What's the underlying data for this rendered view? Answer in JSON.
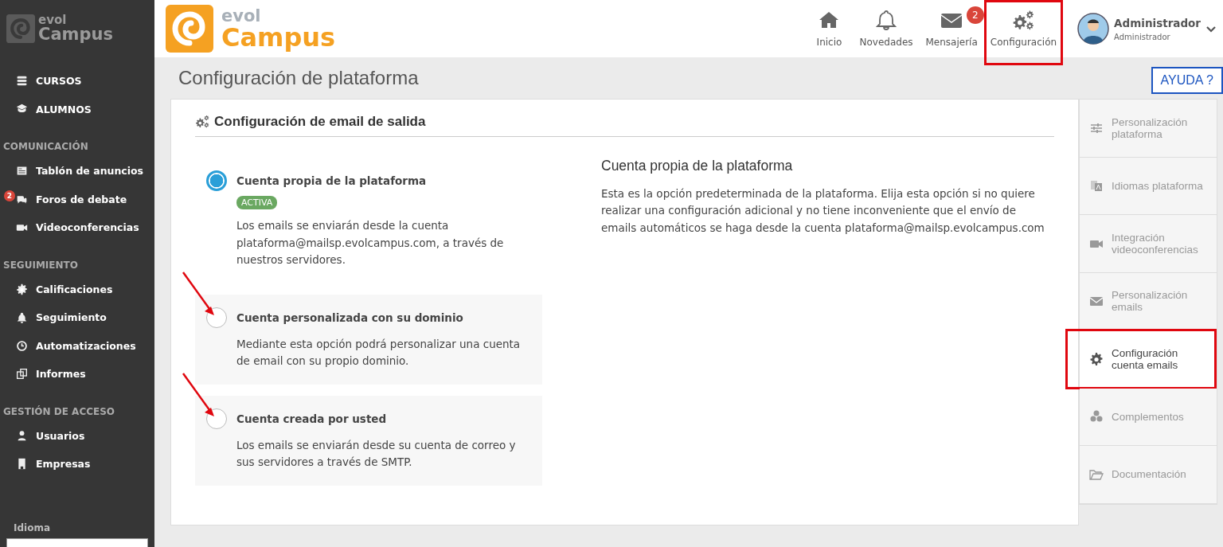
{
  "sidebar": {
    "logo": {
      "top": "evol",
      "bottom": "Campus"
    },
    "sections": [
      {
        "items": [
          {
            "label": "CURSOS"
          },
          {
            "label": "ALUMNOS"
          }
        ]
      },
      {
        "heading": "COMUNICACIÓN",
        "items": [
          {
            "label": "Tablón de anuncios"
          },
          {
            "label": "Foros de debate",
            "badge": "2"
          },
          {
            "label": "Videoconferencias"
          }
        ]
      },
      {
        "heading": "SEGUIMIENTO",
        "items": [
          {
            "label": "Calificaciones"
          },
          {
            "label": "Seguimiento"
          },
          {
            "label": "Automatizaciones"
          },
          {
            "label": "Informes"
          }
        ]
      },
      {
        "heading": "GESTIÓN DE ACCESO",
        "items": [
          {
            "label": "Usuarios"
          },
          {
            "label": "Empresas"
          }
        ]
      }
    ],
    "language": {
      "label": "Idioma"
    }
  },
  "header": {
    "logo": {
      "top": "evol",
      "bottom": "Campus"
    },
    "nav": [
      {
        "label": "Inicio",
        "highlighted": false
      },
      {
        "label": "Novedades",
        "highlighted": false
      },
      {
        "label": "Mensajería",
        "badge": "2",
        "highlighted": false
      },
      {
        "label": "Configuración",
        "highlighted": true
      }
    ],
    "user": {
      "name": "Administrador",
      "role": "Administrador"
    }
  },
  "page": {
    "title": "Configuración de plataforma",
    "help_button": "AYUDA ?"
  },
  "card": {
    "title": "Configuración de email de salida",
    "options": [
      {
        "label": "Cuenta propia de la plataforma",
        "selected": true,
        "badge": "ACTIVA",
        "arrow": false,
        "description": "Los emails se enviarán desde la cuenta plataforma@mailsp.evolcampus.com, a través de nuestros servidores."
      },
      {
        "label": "Cuenta personalizada con su dominio",
        "selected": false,
        "arrow": true,
        "description": "Mediante esta opción podrá personalizar una cuenta de email con su propio dominio."
      },
      {
        "label": "Cuenta creada por usted",
        "selected": false,
        "arrow": true,
        "description": "Los emails se enviarán desde su cuenta de correo y sus servidores a través de SMTP."
      }
    ],
    "detail": {
      "title": "Cuenta propia de la plataforma",
      "text": "Esta es la opción predeterminada de la plataforma. Elija esta opción si no quiere realizar una configuración adicional y no tiene inconveniente que el envío de emails automáticos se haga desde la cuenta plataforma@mailsp.evolcampus.com"
    }
  },
  "side_tabs": [
    {
      "label": "Personalización plataforma",
      "selected": false,
      "highlighted": false
    },
    {
      "label": "Idiomas plataforma",
      "selected": false,
      "highlighted": false
    },
    {
      "label": "Integración videoconferencias",
      "selected": false,
      "highlighted": false
    },
    {
      "label": "Personalización emails",
      "selected": false,
      "highlighted": false
    },
    {
      "label": "Configuración cuenta emails",
      "selected": true,
      "highlighted": true
    },
    {
      "label": "Complementos",
      "selected": false,
      "highlighted": false
    },
    {
      "label": "Documentación",
      "selected": false,
      "highlighted": false
    }
  ]
}
